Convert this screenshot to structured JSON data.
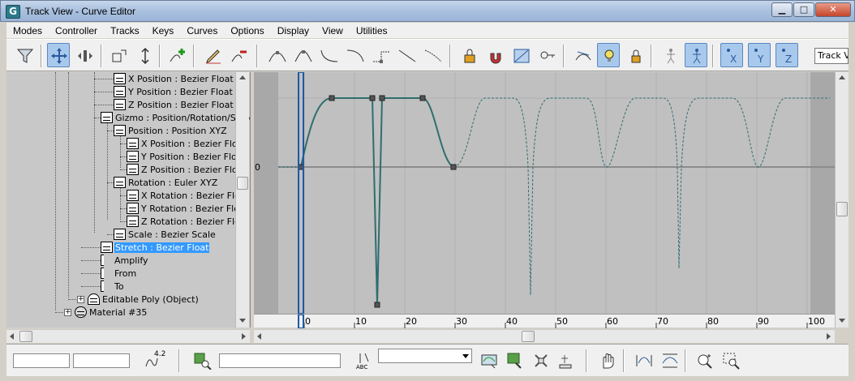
{
  "window": {
    "title": "Track View - Curve Editor",
    "app_icon_letter": "G"
  },
  "menu": [
    "Modes",
    "Controller",
    "Tracks",
    "Keys",
    "Curves",
    "Options",
    "Display",
    "View",
    "Utilities"
  ],
  "toolbar": {
    "track_view_field": "Track Vi"
  },
  "tree": [
    {
      "label": "X Position : Bezier Float"
    },
    {
      "label": "Y Position : Bezier Float"
    },
    {
      "label": "Z Position : Bezier Float"
    },
    {
      "label": "Gizmo : Position/Rotation/Scale"
    },
    {
      "label": "Position : Position XYZ"
    },
    {
      "label": "X Position : Bezier Float"
    },
    {
      "label": "Y Position : Bezier Float"
    },
    {
      "label": "Z Position : Bezier Float"
    },
    {
      "label": "Rotation : Euler XYZ"
    },
    {
      "label": "X Rotation : Bezier Float"
    },
    {
      "label": "Y Rotation : Bezier Float"
    },
    {
      "label": "Z Rotation : Bezier Float"
    },
    {
      "label": "Scale : Bezier Scale"
    },
    {
      "label": "Stretch : Bezier Float",
      "selected": true
    },
    {
      "label": "Amplify"
    },
    {
      "label": "From"
    },
    {
      "label": "To"
    },
    {
      "label": "Editable Poly (Object)"
    },
    {
      "label": "Material #35"
    }
  ],
  "graph": {
    "zero_label": "0"
  },
  "ruler": {
    "ticks": [
      "0",
      "10",
      "20",
      "30",
      "40",
      "50",
      "60",
      "70",
      "80",
      "90",
      "100"
    ]
  },
  "bottom": {
    "soft_value": "4.2",
    "abc_label": "ABC"
  }
}
